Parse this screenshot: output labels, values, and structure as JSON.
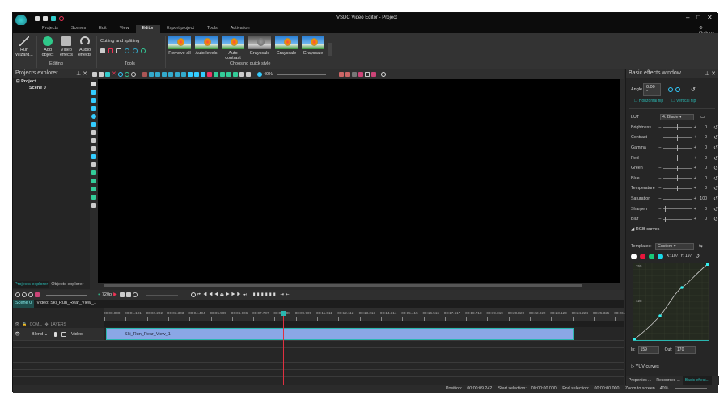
{
  "app": {
    "title": "VSDC Video Editor - Project",
    "options_label": "Options"
  },
  "menu": [
    "Projects",
    "Scenes",
    "Edit",
    "View",
    "Editor",
    "Export project",
    "Tools",
    "Activation"
  ],
  "menu_active": "Editor",
  "ribbon": {
    "editing": {
      "run_wizard": "Run Wizard...",
      "add_object": "Add object",
      "video_effects": "Video effects",
      "audio_effects": "Audio effects",
      "label": "Editing"
    },
    "tools": {
      "cutting": "Cutting and splitting",
      "label": "Tools"
    },
    "quick_style": {
      "label": "Choosing quick style",
      "items": [
        "Remove all",
        "Auto levels",
        "Auto contrast",
        "Grayscale",
        "Grayscale",
        "Grayscale"
      ]
    }
  },
  "projects_explorer": {
    "title": "Projects explorer",
    "tree": [
      "Project",
      "Scene 0"
    ],
    "tabs": [
      "Projects explorer",
      "Objects explorer"
    ]
  },
  "preview_toolbar": {
    "zoom": "40%"
  },
  "timeline": {
    "quality": "720p",
    "tabs": [
      "Scene 0",
      "Video: Ski_Run_Rear_View_1"
    ],
    "ruler": [
      "00:00.000",
      "00:01.101",
      "00:02.202",
      "00:03.303",
      "00:04.404",
      "00:05.505",
      "00:06.606",
      "00:07.707",
      "00:08.808",
      "00:09.909",
      "00:11.011",
      "00:12.112",
      "00:13.213",
      "00:14.314",
      "00:15.415",
      "00:16.516",
      "00:17.617",
      "00:18.718",
      "00:19.819",
      "00:20.920",
      "00:22.022",
      "00:23.123",
      "00:24.224",
      "00:25.325",
      "00:26.426"
    ],
    "header": {
      "com": "COM...",
      "layers": "LAYERS"
    },
    "track": {
      "blend": "Blend",
      "type": "Video",
      "clip": "Ski_Run_Rear_View_1"
    }
  },
  "basic_effects": {
    "title": "Basic effects window",
    "angle_label": "Angle",
    "angle_value": "0.00 °",
    "hflip": "Horizontal flip",
    "vflip": "Vertical flip",
    "lut_label": "LUT",
    "lut_value": "4. Blade",
    "params": [
      {
        "label": "Brightness",
        "value": "0",
        "pos": 0.5
      },
      {
        "label": "Contrast",
        "value": "0",
        "pos": 0.5
      },
      {
        "label": "Gamma",
        "value": "0",
        "pos": 0.5
      },
      {
        "label": "Red",
        "value": "0",
        "pos": 0.5
      },
      {
        "label": "Green",
        "value": "0",
        "pos": 0.5
      },
      {
        "label": "Blue",
        "value": "0",
        "pos": 0.5
      },
      {
        "label": "Temperature",
        "value": "0",
        "pos": 0.5
      },
      {
        "label": "Saturation",
        "value": "100",
        "pos": 0.25
      },
      {
        "label": "Sharpen",
        "value": "0",
        "pos": 0.05
      },
      {
        "label": "Blur",
        "value": "0",
        "pos": 0.05
      }
    ],
    "rgb_curves": "RGB curves",
    "templates_label": "Templates:",
    "templates_value": "Custom",
    "channel_colors": [
      "#ffffff",
      "#e8163c",
      "#18c878",
      "#18d8e8"
    ],
    "coords": "X: 107, Y: 197",
    "curve_labels": [
      "255",
      "128"
    ],
    "in_label": "In:",
    "in_value": "159",
    "out_label": "Out:",
    "out_value": "170",
    "yuv_curves": "YUV curves",
    "bottom_tabs": [
      "Properties ...",
      "Resources ...",
      "Basic effect..."
    ]
  },
  "status": {
    "position_label": "Position:",
    "position": "00:00:09.242",
    "start_label": "Start selection:",
    "start": "00:00:00.000",
    "end_label": "End selection:",
    "end": "00:00:00.000",
    "zoom_label": "Zoom to screen",
    "zoom": "40%"
  },
  "colors": {
    "accent": "#2ab6b0",
    "clip": "#8aa7e6",
    "playhead": "#e03040"
  }
}
